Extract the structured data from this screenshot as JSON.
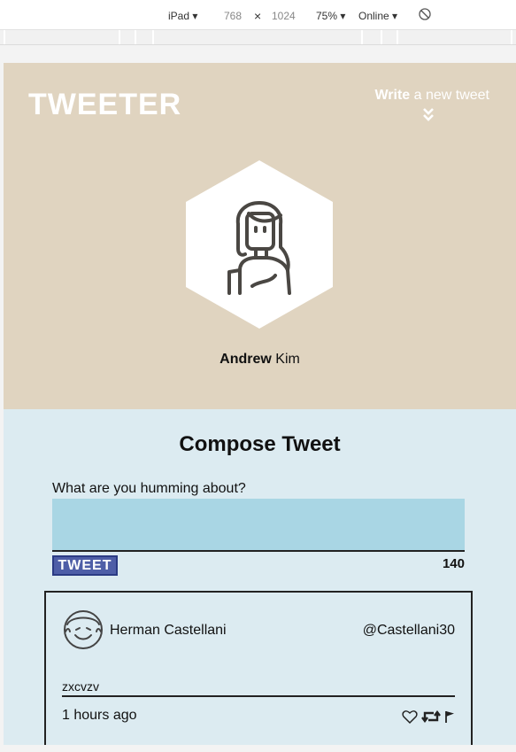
{
  "devtools": {
    "device": "iPad",
    "width": "768",
    "times": "×",
    "height": "1024",
    "zoom": "75%",
    "network": "Online"
  },
  "header": {
    "logo": "TWEETER",
    "write_bold": "Write",
    "write_rest": " a new tweet",
    "user_first": "Andrew",
    "user_last": " Kim"
  },
  "compose": {
    "title": "Compose Tweet",
    "prompt": "What are you humming about?",
    "button": "TWEET",
    "counter": "140"
  },
  "tweet": {
    "author": "Herman Castellani",
    "handle": "@Castellani30",
    "content": "zxcvzv",
    "time": "1 hours ago"
  },
  "icons": [
    "chevron-down-icon",
    "rotate-icon",
    "avatar-icon",
    "heart-icon",
    "retweet-icon",
    "flag-icon"
  ]
}
